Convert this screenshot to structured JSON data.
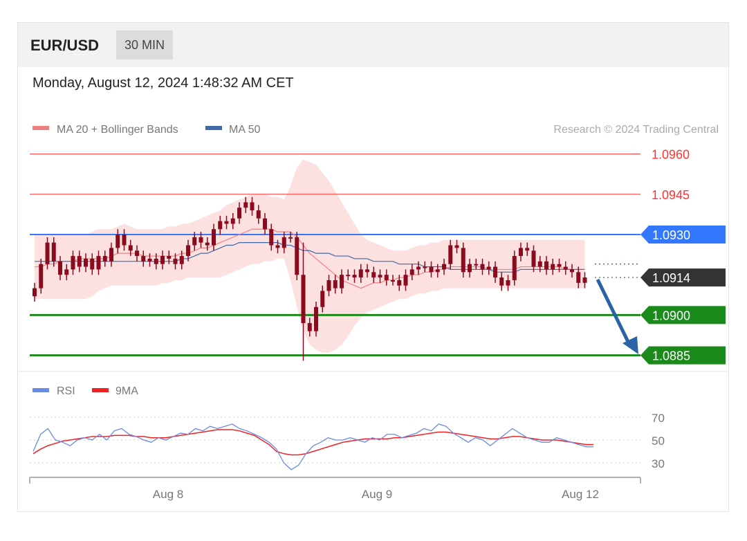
{
  "header": {
    "pair": "EUR/USD",
    "timeframe": "30 MIN"
  },
  "datetime": "Monday, August 12, 2024 1:48:32 AM CET",
  "legend": {
    "bb_label": "MA 20 + Bollinger Bands",
    "ma50_label": "MA 50",
    "credit": "Research © 2024 Trading Central"
  },
  "rsi_legend": {
    "rsi_label": "RSI",
    "ma_label": "9MA"
  },
  "colors": {
    "bb": "#f08080",
    "bb_fill": "#fde0e0",
    "ma50": "#4169a8",
    "resistance": "#ff3333",
    "pivot": "#3377ff",
    "support": "#1a8a1a",
    "current": "#333333",
    "arrow": "#2a62a8",
    "rsi": "#6a8ae6",
    "rsi_ma": "#ee2222",
    "candle": "#8b0a1e"
  },
  "chart_data": {
    "type": "candlestick",
    "x_ticks": [
      "Aug 8",
      "Aug 9",
      "Aug 12"
    ],
    "price_levels": [
      {
        "value": 1.096,
        "label": "1.0960",
        "kind": "resistance"
      },
      {
        "value": 1.0945,
        "label": "1.0945",
        "kind": "resistance"
      },
      {
        "value": 1.093,
        "label": "1.0930",
        "kind": "pivot"
      },
      {
        "value": 1.0914,
        "label": "1.0914",
        "kind": "current"
      },
      {
        "value": 1.09,
        "label": "1.0900",
        "kind": "support"
      },
      {
        "value": 1.0885,
        "label": "1.0885",
        "kind": "support"
      }
    ],
    "close": [
      1.091,
      1.0919,
      1.0927,
      1.092,
      1.0915,
      1.0917,
      1.0922,
      1.0918,
      1.0921,
      1.0917,
      1.0922,
      1.092,
      1.0925,
      1.093,
      1.0926,
      1.0924,
      1.0922,
      1.092,
      1.0921,
      1.0919,
      1.0922,
      1.0921,
      1.0919,
      1.0922,
      1.0926,
      1.0929,
      1.0927,
      1.0926,
      1.0932,
      1.0935,
      1.0934,
      1.0936,
      1.094,
      1.0942,
      1.0939,
      1.0936,
      1.0932,
      1.0926,
      1.0925,
      1.0929,
      1.0929,
      1.0915,
      1.0897,
      1.0894,
      1.0903,
      1.0909,
      1.0913,
      1.091,
      1.0915,
      1.0915,
      1.0914,
      1.0917,
      1.0916,
      1.0914,
      1.0915,
      1.0913,
      1.0913,
      1.0911,
      1.0915,
      1.0917,
      1.0918,
      1.0918,
      1.0916,
      1.0917,
      1.0919,
      1.0926,
      1.0925,
      1.0916,
      1.0919,
      1.0919,
      1.0917,
      1.0918,
      1.0914,
      1.0911,
      1.0913,
      1.0922,
      1.0925,
      1.0924,
      1.0918,
      1.092,
      1.0917,
      1.0919,
      1.0918,
      1.0917,
      1.0916,
      1.0912,
      1.0914
    ],
    "ma20": [
      1.0918,
      1.0918,
      1.0919,
      1.0919,
      1.092,
      1.092,
      1.092,
      1.0921,
      1.0921,
      1.0921,
      1.0921,
      1.0921,
      1.0922,
      1.0923,
      1.0923,
      1.0923,
      1.0923,
      1.0922,
      1.0922,
      1.0922,
      1.0922,
      1.0922,
      1.0922,
      1.0923,
      1.0923,
      1.0924,
      1.0925,
      1.0925,
      1.0926,
      1.0927,
      1.0928,
      1.0929,
      1.093,
      1.0931,
      1.0932,
      1.0932,
      1.0932,
      1.0932,
      1.0931,
      1.0931,
      1.0931,
      1.0929,
      1.0926,
      1.0923,
      1.0921,
      1.0919,
      1.0917,
      1.0915,
      1.0913,
      1.0912,
      1.0911,
      1.091,
      1.0911,
      1.0912,
      1.0912,
      1.0913,
      1.0913,
      1.0914,
      1.0914,
      1.0915,
      1.0915,
      1.0916,
      1.0916,
      1.0917,
      1.0917,
      1.0918,
      1.0918,
      1.0918,
      1.0918,
      1.0918,
      1.0918,
      1.0917,
      1.0917,
      1.0917,
      1.0917,
      1.0917,
      1.0918,
      1.0918,
      1.0918,
      1.0918,
      1.0918,
      1.0918,
      1.0918,
      1.0917,
      1.0917,
      1.0917,
      1.0917
    ],
    "bb_upper": [
      1.093,
      1.093,
      1.093,
      1.093,
      1.093,
      1.093,
      1.093,
      1.093,
      1.093,
      1.0931,
      1.0932,
      1.0932,
      1.0932,
      1.0933,
      1.0934,
      1.0933,
      1.0932,
      1.0932,
      1.0932,
      1.0932,
      1.0932,
      1.0933,
      1.0933,
      1.0934,
      1.0934,
      1.0935,
      1.0936,
      1.0937,
      1.0938,
      1.0939,
      1.0941,
      1.0942,
      1.0943,
      1.0944,
      1.0945,
      1.0945,
      1.0945,
      1.0944,
      1.0944,
      1.0943,
      1.0948,
      1.0955,
      1.0958,
      1.0957,
      1.0956,
      1.0953,
      1.095,
      1.0946,
      1.0942,
      1.0938,
      1.0934,
      1.093,
      1.0928,
      1.0927,
      1.0926,
      1.0925,
      1.0924,
      1.0924,
      1.0924,
      1.0925,
      1.0926,
      1.0926,
      1.0927,
      1.0927,
      1.0928,
      1.0928,
      1.0928,
      1.0928,
      1.0928,
      1.0928,
      1.0928,
      1.0928,
      1.0928,
      1.0928,
      1.0928,
      1.0928,
      1.0928,
      1.0928,
      1.0928,
      1.0928,
      1.0928,
      1.0928,
      1.0928,
      1.0928,
      1.0928,
      1.0928,
      1.0928
    ],
    "bb_lower": [
      1.0906,
      1.0906,
      1.0906,
      1.0906,
      1.0906,
      1.0906,
      1.0906,
      1.0906,
      1.0906,
      1.0907,
      1.0909,
      1.091,
      1.0911,
      1.0911,
      1.0911,
      1.0911,
      1.0911,
      1.0911,
      1.0911,
      1.0911,
      1.0912,
      1.0912,
      1.0913,
      1.0913,
      1.0914,
      1.0914,
      1.0914,
      1.0914,
      1.0914,
      1.0914,
      1.0915,
      1.0916,
      1.0917,
      1.0918,
      1.0919,
      1.0919,
      1.092,
      1.092,
      1.0921,
      1.0921,
      1.0913,
      1.0903,
      1.0894,
      1.0889,
      1.0887,
      1.0886,
      1.0886,
      1.0887,
      1.0889,
      1.0892,
      1.0896,
      1.0899,
      1.0901,
      1.0902,
      1.0903,
      1.0904,
      1.0905,
      1.0906,
      1.0906,
      1.0907,
      1.0908,
      1.0908,
      1.0909,
      1.0909,
      1.091,
      1.091,
      1.091,
      1.091,
      1.091,
      1.091,
      1.091,
      1.091,
      1.091,
      1.091,
      1.091,
      1.091,
      1.091,
      1.091,
      1.091,
      1.091,
      1.091,
      1.091,
      1.091,
      1.091,
      1.091,
      1.091,
      1.091
    ],
    "ma50": [
      1.092,
      1.092,
      1.092,
      1.092,
      1.092,
      1.092,
      1.092,
      1.092,
      1.092,
      1.092,
      1.092,
      1.092,
      1.092,
      1.092,
      1.092,
      1.092,
      1.092,
      1.092,
      1.092,
      1.092,
      1.092,
      1.092,
      1.092,
      1.0921,
      1.0921,
      1.0922,
      1.0923,
      1.0923,
      1.0924,
      1.0925,
      1.0926,
      1.0926,
      1.0927,
      1.0927,
      1.0927,
      1.0927,
      1.0927,
      1.0927,
      1.0927,
      1.0926,
      1.0926,
      1.0925,
      1.0924,
      1.0924,
      1.0923,
      1.0923,
      1.0923,
      1.0922,
      1.0922,
      1.0922,
      1.0921,
      1.0921,
      1.0921,
      1.092,
      1.092,
      1.092,
      1.092,
      1.0919,
      1.0919,
      1.0919,
      1.0919,
      1.0918,
      1.0918,
      1.0918,
      1.0918,
      1.0917,
      1.0917,
      1.0917,
      1.0917,
      1.0917,
      1.0917,
      1.0917,
      1.0916,
      1.0916,
      1.0916,
      1.0916,
      1.0917,
      1.0917,
      1.0917,
      1.0917,
      1.0917,
      1.0917,
      1.0917,
      1.0917,
      1.0917,
      1.0917,
      1.0917
    ],
    "rsi": {
      "ticks": [
        70,
        50,
        30
      ],
      "rsi": [
        40,
        55,
        60,
        50,
        48,
        45,
        50,
        52,
        50,
        55,
        50,
        58,
        60,
        55,
        53,
        50,
        48,
        52,
        50,
        53,
        56,
        55,
        60,
        58,
        62,
        60,
        62,
        64,
        60,
        58,
        55,
        52,
        48,
        42,
        30,
        24,
        28,
        38,
        45,
        48,
        52,
        50,
        50,
        52,
        50,
        48,
        52,
        50,
        55,
        55,
        52,
        54,
        56,
        60,
        58,
        64,
        62,
        56,
        52,
        48,
        52,
        50,
        45,
        50,
        55,
        60,
        56,
        52,
        50,
        48,
        48,
        52,
        50,
        48,
        46,
        44,
        44
      ],
      "ma9": [
        38,
        42,
        45,
        47,
        49,
        50,
        51,
        52,
        53,
        53,
        53,
        54,
        54,
        54,
        53,
        53,
        52,
        52,
        52,
        53,
        54,
        55,
        56,
        57,
        58,
        59,
        59,
        59,
        58,
        56,
        54,
        50,
        46,
        40,
        38,
        37,
        37,
        38,
        40,
        42,
        44,
        46,
        48,
        49,
        50,
        51,
        51,
        51,
        51,
        52,
        52,
        53,
        54,
        55,
        56,
        57,
        57,
        56,
        55,
        54,
        53,
        52,
        51,
        51,
        52,
        53,
        53,
        52,
        51,
        50,
        50,
        50,
        49,
        48,
        47,
        46,
        46
      ]
    }
  }
}
